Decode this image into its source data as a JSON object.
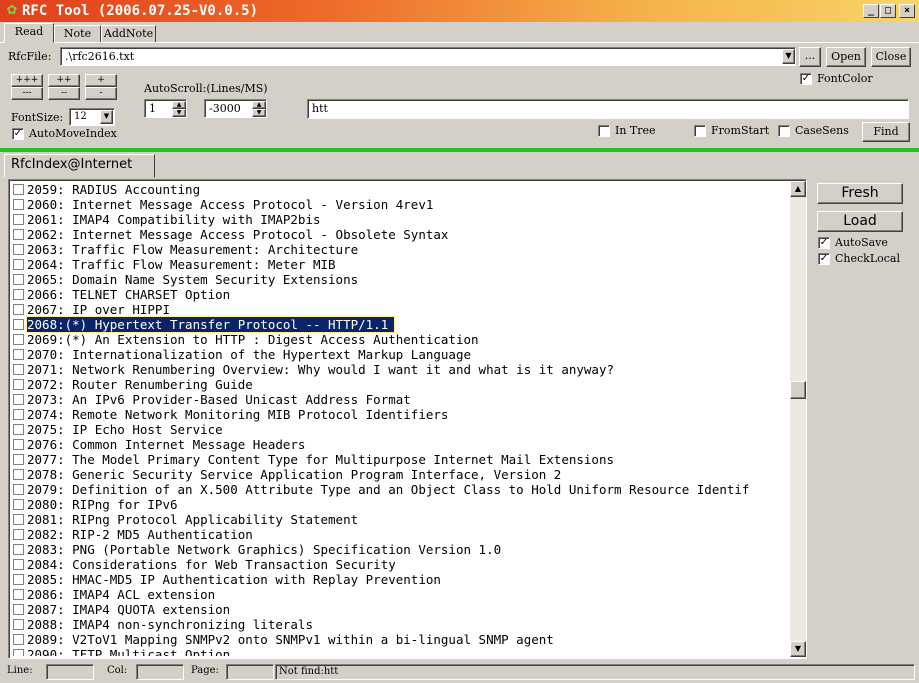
{
  "window": {
    "title": "RFC Tool (2006.07.25-V0.0.5)",
    "app_icon": "rfc-tool-icon",
    "caption_buttons": {
      "minimize": "_",
      "maximize": "□",
      "close": "×"
    }
  },
  "tabs": [
    {
      "label": "Read"
    },
    {
      "label": "Note"
    },
    {
      "label": "AddNote"
    }
  ],
  "toolbar": {
    "rfcfile_label": "RfcFile:",
    "rfcfile_value": ".\\rfc2616.txt",
    "browse_label": "...",
    "open_label": "Open",
    "close_label": "Close",
    "fontcolor_label": "FontColor",
    "fontcolor_checked": true,
    "size_buttons": [
      "+++",
      "++",
      "+",
      "---",
      "--",
      "-"
    ],
    "autoscroll_label": "AutoScroll:(Lines/MS)",
    "lines_value": "1",
    "ms_value": "-3000",
    "search_value": "htt",
    "fontsize_label": "FontSize:",
    "fontsize_value": "12",
    "automoveindex_label": "AutoMoveIndex",
    "automoveindex_checked": true,
    "intree_label": "In Tree",
    "fromstart_label": "FromStart",
    "casesens_label": "CaseSens",
    "find_label": "Find"
  },
  "panel_tab": {
    "label": "RfcIndex@Internet"
  },
  "side": {
    "fresh_label": "Fresh",
    "load_label": "Load",
    "autosave_label": "AutoSave",
    "autosave_checked": true,
    "checklocal_label": "CheckLocal",
    "checklocal_checked": true
  },
  "rfc_list": {
    "selected_index": 9,
    "items": [
      "2059: RADIUS Accounting",
      "2060: Internet Message Access Protocol - Version 4rev1",
      "2061: IMAP4 Compatibility with IMAP2bis",
      "2062: Internet Message Access Protocol - Obsolete Syntax",
      "2063: Traffic Flow Measurement: Architecture",
      "2064: Traffic Flow Measurement: Meter MIB",
      "2065: Domain Name System Security Extensions",
      "2066: TELNET CHARSET Option",
      "2067: IP over HIPPI",
      "2068:(*) Hypertext Transfer Protocol -- HTTP/1.1",
      "2069:(*) An Extension to HTTP : Digest Access Authentication",
      "2070: Internationalization of the Hypertext Markup Language",
      "2071: Network Renumbering Overview: Why would I want it and what is it anyway?",
      "2072: Router Renumbering Guide",
      "2073: An IPv6 Provider-Based Unicast Address Format",
      "2074: Remote Network Monitoring MIB Protocol Identifiers",
      "2075: IP Echo Host Service",
      "2076: Common Internet Message Headers",
      "2077: The Model Primary Content Type for Multipurpose Internet Mail Extensions",
      "2078: Generic Security Service Application Program Interface, Version 2",
      "2079: Definition of an X.500 Attribute Type and an Object Class to Hold Uniform Resource Identif",
      "2080: RIPng for IPv6",
      "2081: RIPng Protocol Applicability Statement",
      "2082: RIP-2 MD5 Authentication",
      "2083: PNG (Portable Network Graphics) Specification Version 1.0",
      "2084: Considerations for Web Transaction Security",
      "2085: HMAC-MD5 IP Authentication with Replay Prevention",
      "2086: IMAP4 ACL extension",
      "2087: IMAP4 QUOTA extension",
      "2088: IMAP4 non-synchronizing literals",
      "2089: V2ToV1 Mapping SNMPv2 onto SNMPv1 within a bi-lingual SNMP agent",
      "2090: TFTP Multicast Option"
    ]
  },
  "status": {
    "line_label": "Line:",
    "col_label": "Col:",
    "page_label": "Page:",
    "message": "Not find:htt"
  },
  "colors": {
    "green_divider": "#18c818",
    "selection": "#0a246a"
  }
}
